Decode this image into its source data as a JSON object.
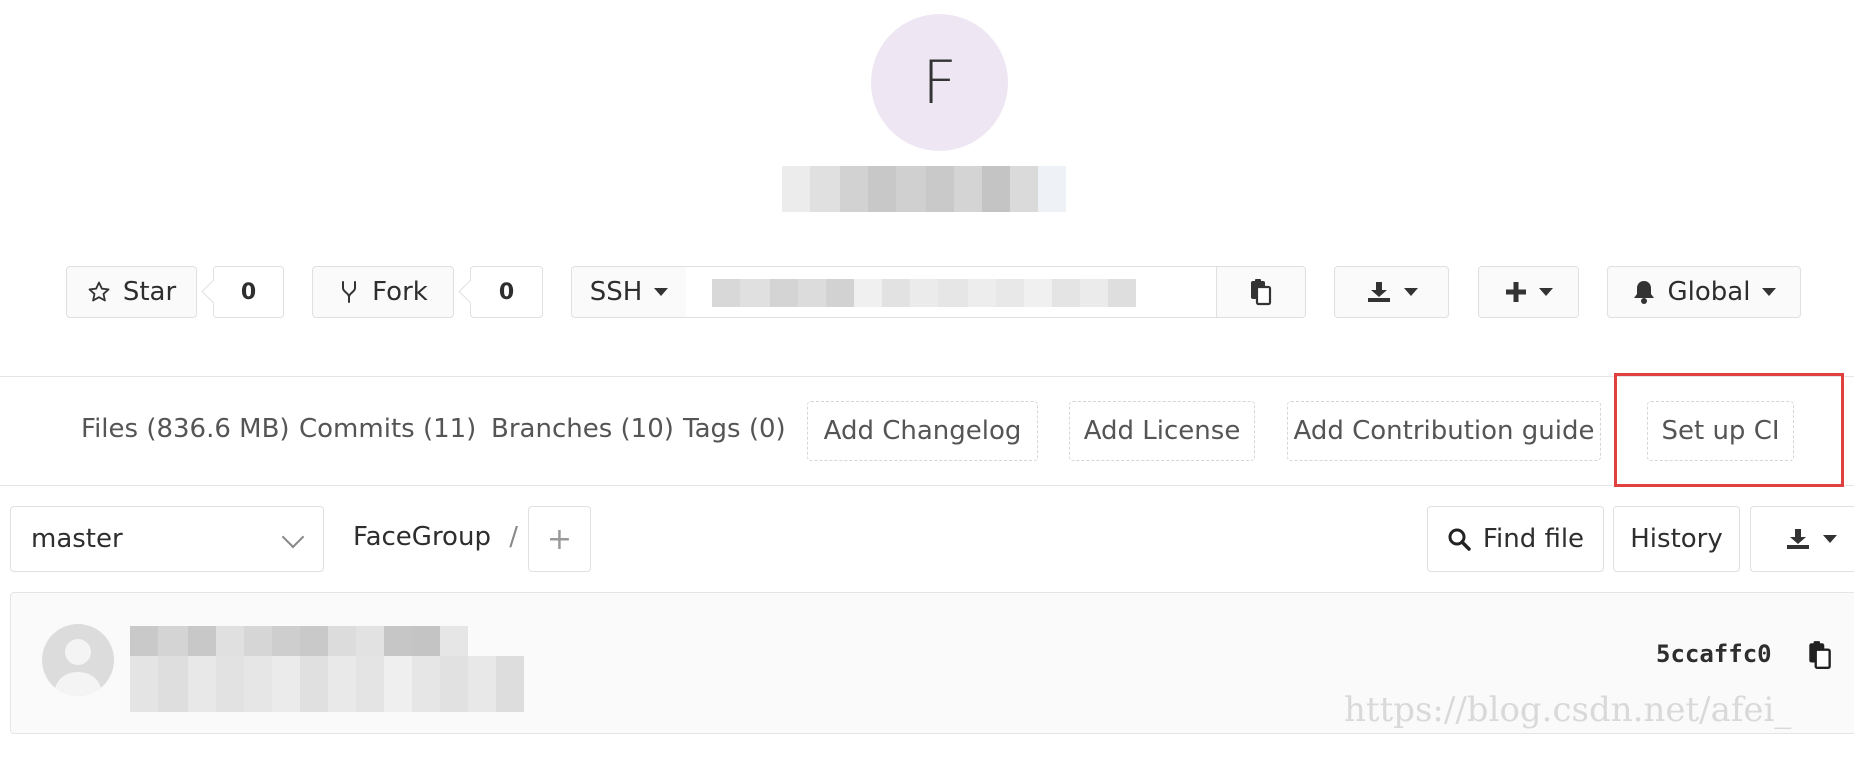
{
  "project": {
    "avatar_letter": "F"
  },
  "actions": {
    "star_label": "Star",
    "star_count": "0",
    "fork_label": "Fork",
    "fork_count": "0",
    "clone_protocol": "SSH",
    "notifications_label": "Global"
  },
  "stats": {
    "files": "Files (836.6 MB)",
    "commits": "Commits (11)",
    "branches": "Branches (10)",
    "tags": "Tags (0)",
    "add_changelog": "Add Changelog",
    "add_license": "Add License",
    "add_contribution": "Add Contribution guide",
    "setup_ci": "Set up CI"
  },
  "tree": {
    "branch": "master",
    "path": "FaceGroup",
    "path_separator": "/",
    "add_symbol": "+",
    "find_file": "Find file",
    "history": "History"
  },
  "commit": {
    "sha": "5ccaffc0"
  },
  "watermark": "https://blog.csdn.net/afei_",
  "icons": [
    "star-icon",
    "fork-icon",
    "clipboard-icon",
    "download-icon",
    "plus-icon",
    "bell-icon",
    "search-icon",
    "chevron-down-icon"
  ],
  "colors": {
    "avatar_bg": "#efe6f3",
    "highlight_border": "#e04040",
    "panel_bg": "#fafafa"
  }
}
